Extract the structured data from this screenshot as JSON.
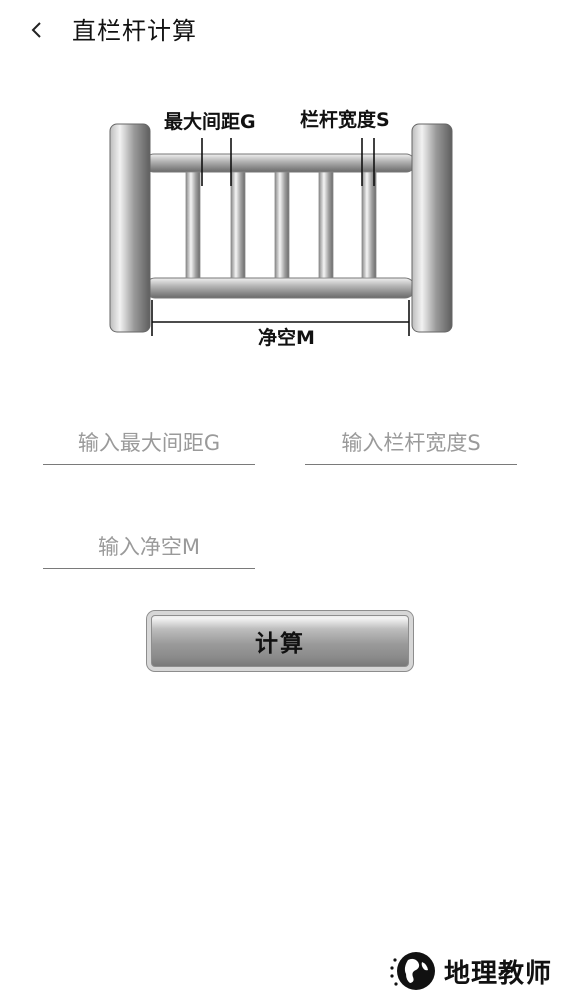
{
  "header": {
    "title": "直栏杆计算"
  },
  "diagram": {
    "label_spacing": "最大间距G",
    "label_width": "栏杆宽度S",
    "label_clear": "净空M"
  },
  "inputs": {
    "spacing_placeholder": "输入最大间距G",
    "width_placeholder": "输入栏杆宽度S",
    "clear_placeholder": "输入净空M"
  },
  "button": {
    "calculate_label": "计算"
  },
  "watermark": {
    "text": "地理教师"
  }
}
